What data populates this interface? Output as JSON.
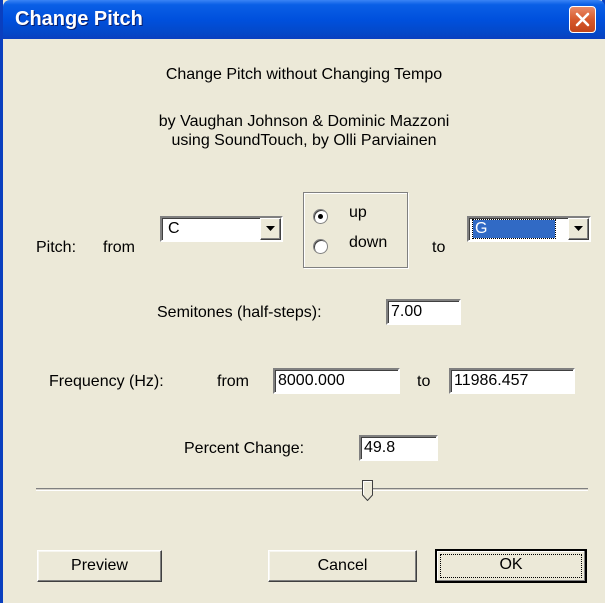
{
  "window": {
    "title": "Change Pitch"
  },
  "header": {
    "line1": "Change Pitch without Changing Tempo",
    "line2": "by Vaughan Johnson & Dominic Mazzoni",
    "line3": "using SoundTouch, by Olli Parviainen"
  },
  "pitch": {
    "label": "Pitch:",
    "from_label": "from",
    "from_value": "C",
    "to_label": "to",
    "to_value": "G",
    "direction": {
      "up_label": "up",
      "down_label": "down",
      "selected": "up"
    }
  },
  "semitones": {
    "label": "Semitones (half-steps):",
    "value": "7.00"
  },
  "frequency": {
    "label": "Frequency (Hz):",
    "from_label": "from",
    "from_value": "8000.000",
    "to_label": "to",
    "to_value": "11986.457"
  },
  "percent": {
    "label": "Percent Change:",
    "value": "49.8"
  },
  "slider": {
    "value_fraction": 0.6
  },
  "buttons": {
    "preview": "Preview",
    "cancel": "Cancel",
    "ok": "OK"
  },
  "icons": {
    "close": "close-icon",
    "dropdown": "chevron-down-icon"
  },
  "colors": {
    "titlebar": "#0054e3",
    "close_button": "#d75a2d",
    "dialog_bg": "#ece9d8",
    "selection": "#316ac5"
  }
}
